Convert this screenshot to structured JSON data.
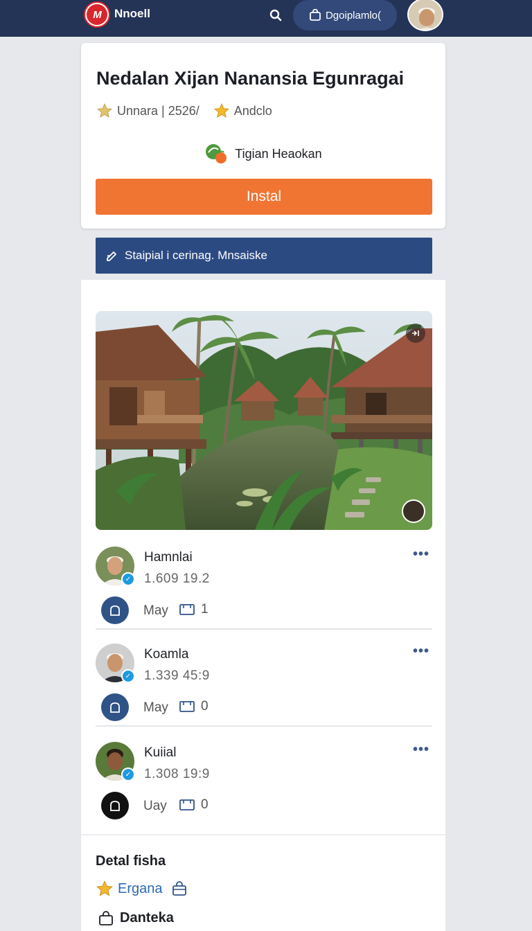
{
  "topbar": {
    "logo_text": "M",
    "brand": "Nnoell",
    "pill_label": "Dgoiplamlo(",
    "colors": {
      "bg": "#243456",
      "pill": "#33497a"
    }
  },
  "app": {
    "title": "Nedalan Xijan Nanansia Egunragai",
    "rating_text": "Unnara | 2526/",
    "category": "Andclo",
    "developer": "Tigian Heaokan",
    "install_label": "Instal",
    "install_color": "#f07432"
  },
  "banner": {
    "label": "Staipial i cerinag. Mnsaiske",
    "color": "#2c4a82"
  },
  "comments": [
    {
      "name": "Hamnlai",
      "meta": "1.609  19.2",
      "date": "May",
      "replies": "1"
    },
    {
      "name": "Koamla",
      "meta": "1.339  45:9",
      "date": "May",
      "replies": "0"
    },
    {
      "name": "Kuiial",
      "meta": "1.308  19:9",
      "date": "Uay",
      "replies": "0"
    }
  ],
  "details": {
    "title": "Detal fisha",
    "tag": "Ergana",
    "item": "Danteka"
  }
}
